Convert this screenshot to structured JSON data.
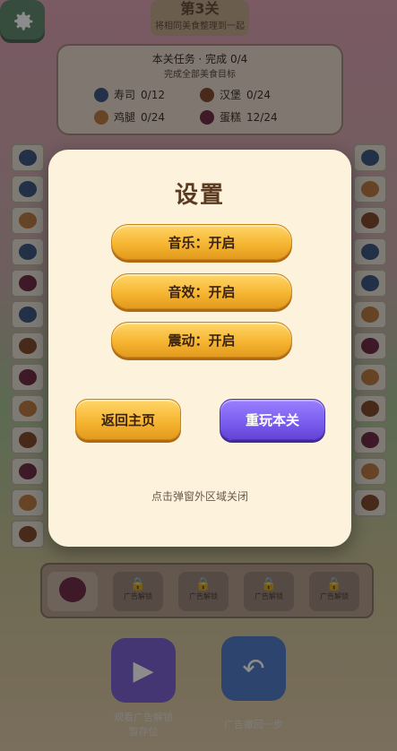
{
  "level_badge": {
    "level": "第3关",
    "subtitle": "将相同美食整理到一起"
  },
  "task_panel": {
    "title": "本关任务 · 完成 0/4",
    "subtitle": "完成全部美食目标",
    "items": [
      {
        "name": "寿司",
        "progress": "0/12",
        "icon": "sushi-icon",
        "color": "#3b5a8a"
      },
      {
        "name": "汉堡",
        "progress": "0/24",
        "icon": "burger-icon",
        "color": "#8a4a2a"
      },
      {
        "name": "鸡腿",
        "progress": "0/24",
        "icon": "drumstick-icon",
        "color": "#c47a3a"
      },
      {
        "name": "蛋糕",
        "progress": "12/24",
        "icon": "cake-icon",
        "color": "#7a2a4a"
      }
    ]
  },
  "tray": {
    "slots": [
      {
        "icon": "cake-icon",
        "label": ""
      },
      {
        "icon": "lock-icon",
        "label": "广告解锁"
      },
      {
        "icon": "lock-icon",
        "label": "广告解锁"
      },
      {
        "icon": "lock-icon",
        "label": "广告解锁"
      },
      {
        "icon": "lock-icon",
        "label": "广告解锁"
      }
    ]
  },
  "powerups": {
    "unlock_slot_label": "观看广告解锁\n暂存位",
    "undo_label": "广告撤回一步"
  },
  "modal": {
    "title": "设置",
    "music": "音乐：开启",
    "sound": "音效：开启",
    "vibration": "震动：开启",
    "home": "返回主页",
    "replay": "重玩本关",
    "hint": "点击弹窗外区域关闭"
  },
  "colors": {
    "accent_gold": "#f6b632",
    "accent_purple": "#7b5ff0",
    "modal_bg": "#fdf3dc",
    "title_brown": "#5a3a20"
  }
}
